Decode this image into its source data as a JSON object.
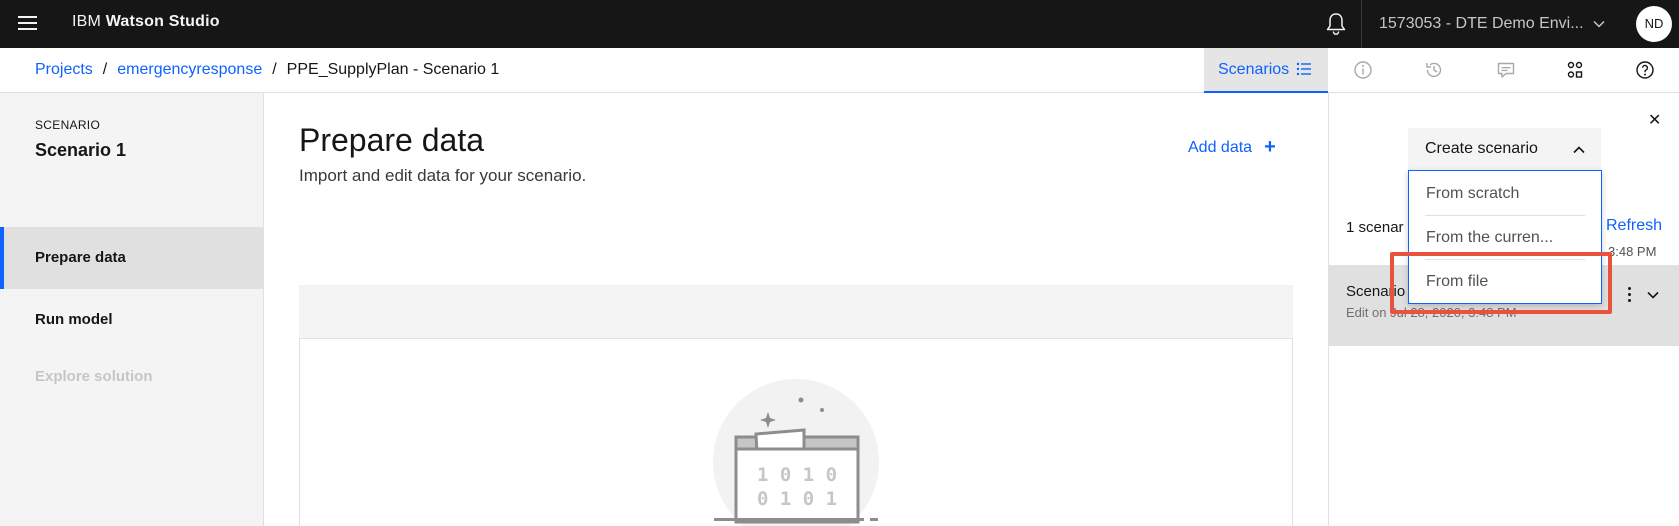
{
  "header": {
    "brand_light": "IBM",
    "brand_bold": "Watson Studio",
    "account_label": "1573053 - DTE Demo Envi...",
    "avatar_initials": "ND"
  },
  "breadcrumb": {
    "items": [
      "Projects",
      "emergencyresponse"
    ],
    "separator": "/",
    "current": "PPE_SupplyPlan - Scenario 1"
  },
  "toolbar": {
    "scenarios_tab_label": "Scenarios",
    "icons": [
      "info-icon",
      "history-icon",
      "comment-icon",
      "model-icon",
      "help-icon"
    ]
  },
  "sidebar": {
    "kicker": "SCENARIO",
    "scenario_name": "Scenario 1",
    "items": [
      {
        "label": "Prepare data",
        "state": "active"
      },
      {
        "label": "Run model",
        "state": "enabled"
      },
      {
        "label": "Explore solution",
        "state": "disabled"
      }
    ]
  },
  "main": {
    "title": "Prepare data",
    "subtitle": "Import and edit data for your scenario.",
    "add_data_label": "Add data",
    "illustration_text_line1": "1 0 1 0",
    "illustration_text_line2": "0 1 0 1"
  },
  "panel": {
    "close_icon": "close-icon",
    "create_label": "Create scenario",
    "menu_items": [
      "From scratch",
      "From the curren...",
      "From file"
    ],
    "highlighted_item": "From file",
    "count_text": "1 scenar",
    "refresh_label": "Refresh",
    "time_text": "3:48 PM",
    "row_title": "Scenario",
    "row_meta": "Edit on Jul 28, 2020, 3:48 PM"
  },
  "colors": {
    "accent": "#0f62fe",
    "header_bg": "#161616",
    "highlight": "#e8533d"
  }
}
